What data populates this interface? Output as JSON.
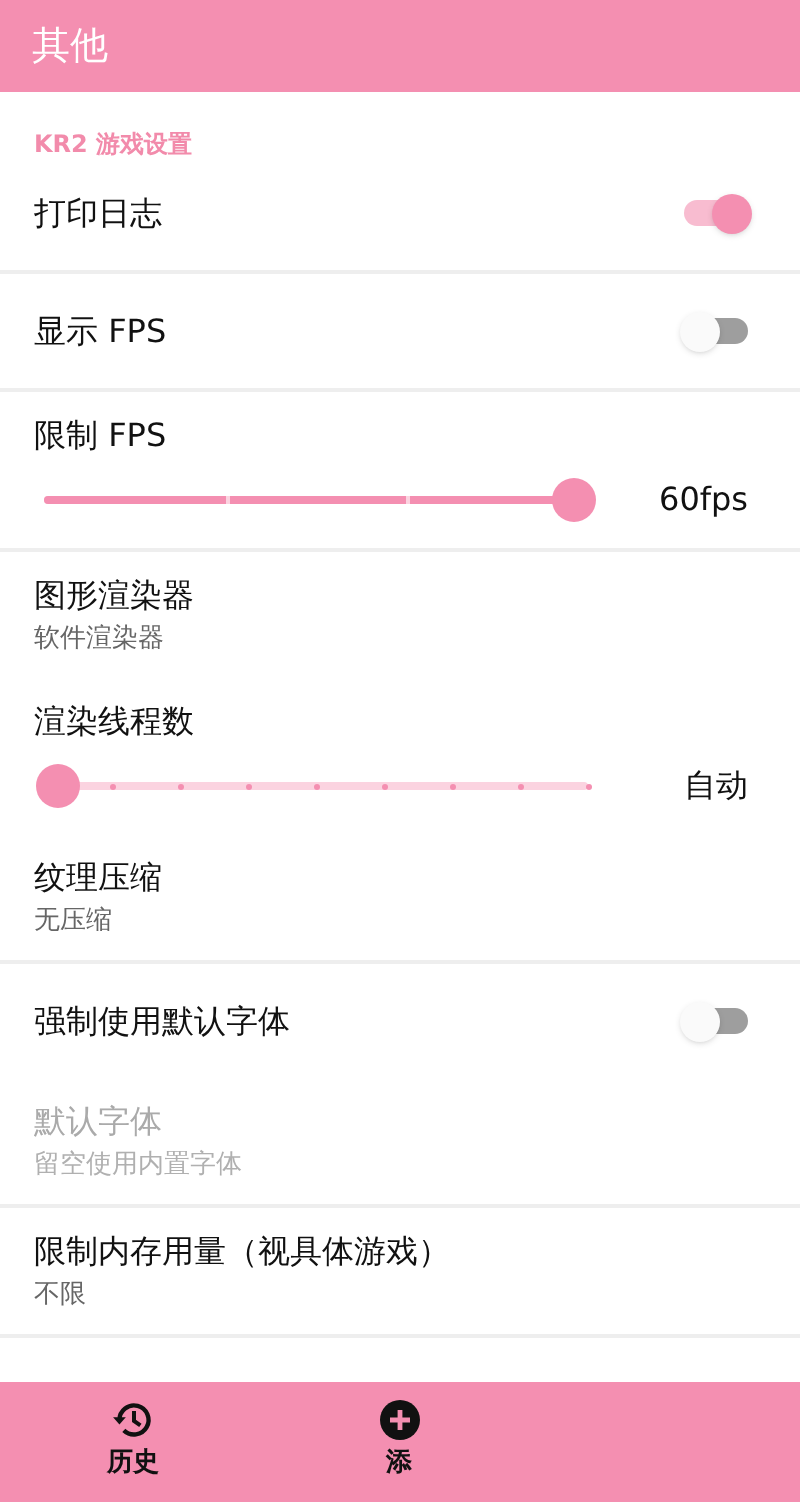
{
  "app_bar": {
    "title": "其他"
  },
  "groups": [
    {
      "items": [
        {
          "kind": "header",
          "title": "KR2 游戏设置"
        },
        {
          "kind": "switch",
          "title": "打印日志",
          "on": true
        }
      ]
    },
    {
      "items": [
        {
          "kind": "switch",
          "title": "显示 FPS",
          "on": false
        }
      ]
    },
    {
      "items": [
        {
          "kind": "segmented_slider",
          "title": "限制 FPS",
          "level": 1,
          "reading": "60fps"
        }
      ]
    },
    {
      "items": [
        {
          "kind": "value",
          "title": "图形渲染器",
          "value": "软件渲染器",
          "disabled": false
        },
        {
          "kind": "dotted_slider",
          "title": "渲染线程数",
          "level": 0,
          "reading": "自动"
        },
        {
          "kind": "value",
          "title": "纹理压缩",
          "value": "无压缩",
          "disabled": false
        }
      ]
    },
    {
      "items": [
        {
          "kind": "switch",
          "title": "强制使用默认字体",
          "on": false
        },
        {
          "kind": "value",
          "title": "默认字体",
          "value": "留空使用内置字体",
          "disabled": true
        }
      ]
    },
    {
      "items": [
        {
          "kind": "value",
          "title": "限制内存用量（视具体游戏）",
          "value": "不限",
          "disabled": false
        }
      ]
    }
  ],
  "bottom_nav": [
    {
      "kind": "history",
      "label": "历史"
    },
    {
      "kind": "add",
      "label": "添"
    }
  ]
}
